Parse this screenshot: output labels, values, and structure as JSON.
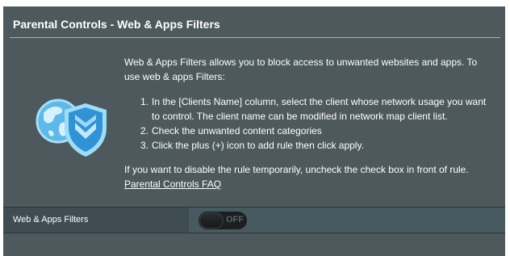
{
  "header": {
    "title": "Parental Controls - Web & Apps Filters"
  },
  "logo": {
    "icon": "globe-shield-icon",
    "colors": {
      "globe": "#4fb3e8",
      "shield": "#2a8fd4",
      "shield_light": "#7fd0f7"
    }
  },
  "description": {
    "intro": "Web & Apps Filters allows you to block access to unwanted websites and apps. To use web & apps Filters:",
    "steps": [
      {
        "num": "1.",
        "text": "In the [Clients Name] column, select the client whose network usage you want to control. The client name can be modified in network map client list."
      },
      {
        "num": "2.",
        "text": "Check the unwanted content categories"
      },
      {
        "num": "3.",
        "text": "Click the plus (+) icon to add rule then click apply."
      }
    ],
    "disable_note": "If you want to disable the rule temporarily, uncheck the check box in front of rule.",
    "faq_link": "Parental Controls FAQ"
  },
  "filter_row": {
    "label": "Web & Apps Filters",
    "toggle_state": "OFF"
  },
  "colors": {
    "panel_bg": "#4d595d",
    "label_bg": "#3f4c51",
    "text": "#ffffff"
  }
}
